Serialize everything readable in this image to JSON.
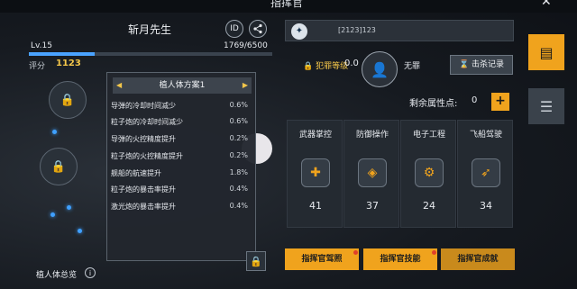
{
  "window": {
    "title": "指挥官",
    "close_glyph": "✕"
  },
  "commander": {
    "name": "斩月先生",
    "id_button": "ID",
    "level": "Lv.15",
    "xp_text": "1769/6500",
    "xp_fraction": 0.272,
    "score_label": "评分",
    "score_value": "1123"
  },
  "implant": {
    "scheme_title": "植人体方案1",
    "rows": [
      {
        "label": "导弹的冷却时间减少",
        "value": "0.6%"
      },
      {
        "label": "粒子炮的冷却时间减少",
        "value": "0.6%"
      },
      {
        "label": "导弹的火控精度提升",
        "value": "0.2%"
      },
      {
        "label": "粒子炮的火控精度提升",
        "value": "0.2%"
      },
      {
        "label": "舰船的航速提升",
        "value": "1.8%"
      },
      {
        "label": "粒子炮的暴击率提升",
        "value": "0.4%"
      },
      {
        "label": "激光炮的暴击率提升",
        "value": "0.4%"
      }
    ],
    "overview_label": "植人体总览",
    "info_glyph": "i"
  },
  "profile": {
    "id_text": "[2123]123",
    "crime_label": "犯罪等级",
    "crime_value": "0.0",
    "status": "无罪",
    "kill_record_button": "击杀记录"
  },
  "attributes": {
    "remaining_label": "剩余属性点:",
    "remaining_value": "0",
    "plus": "+",
    "skills": [
      {
        "label": "武器掌控",
        "value": "41",
        "icon": "weapon-icon"
      },
      {
        "label": "防御操作",
        "value": "37",
        "icon": "shield-icon"
      },
      {
        "label": "电子工程",
        "value": "24",
        "icon": "electronics-icon"
      },
      {
        "label": "飞船驾驶",
        "value": "34",
        "icon": "pilot-icon"
      }
    ]
  },
  "bottom_buttons": {
    "license": "指挥官驾照",
    "skills": "指挥官技能",
    "achievement": "指挥官成就"
  },
  "colors": {
    "accent": "#f0a31d",
    "score": "#f3c64a",
    "xp": "#4aa3ff"
  }
}
